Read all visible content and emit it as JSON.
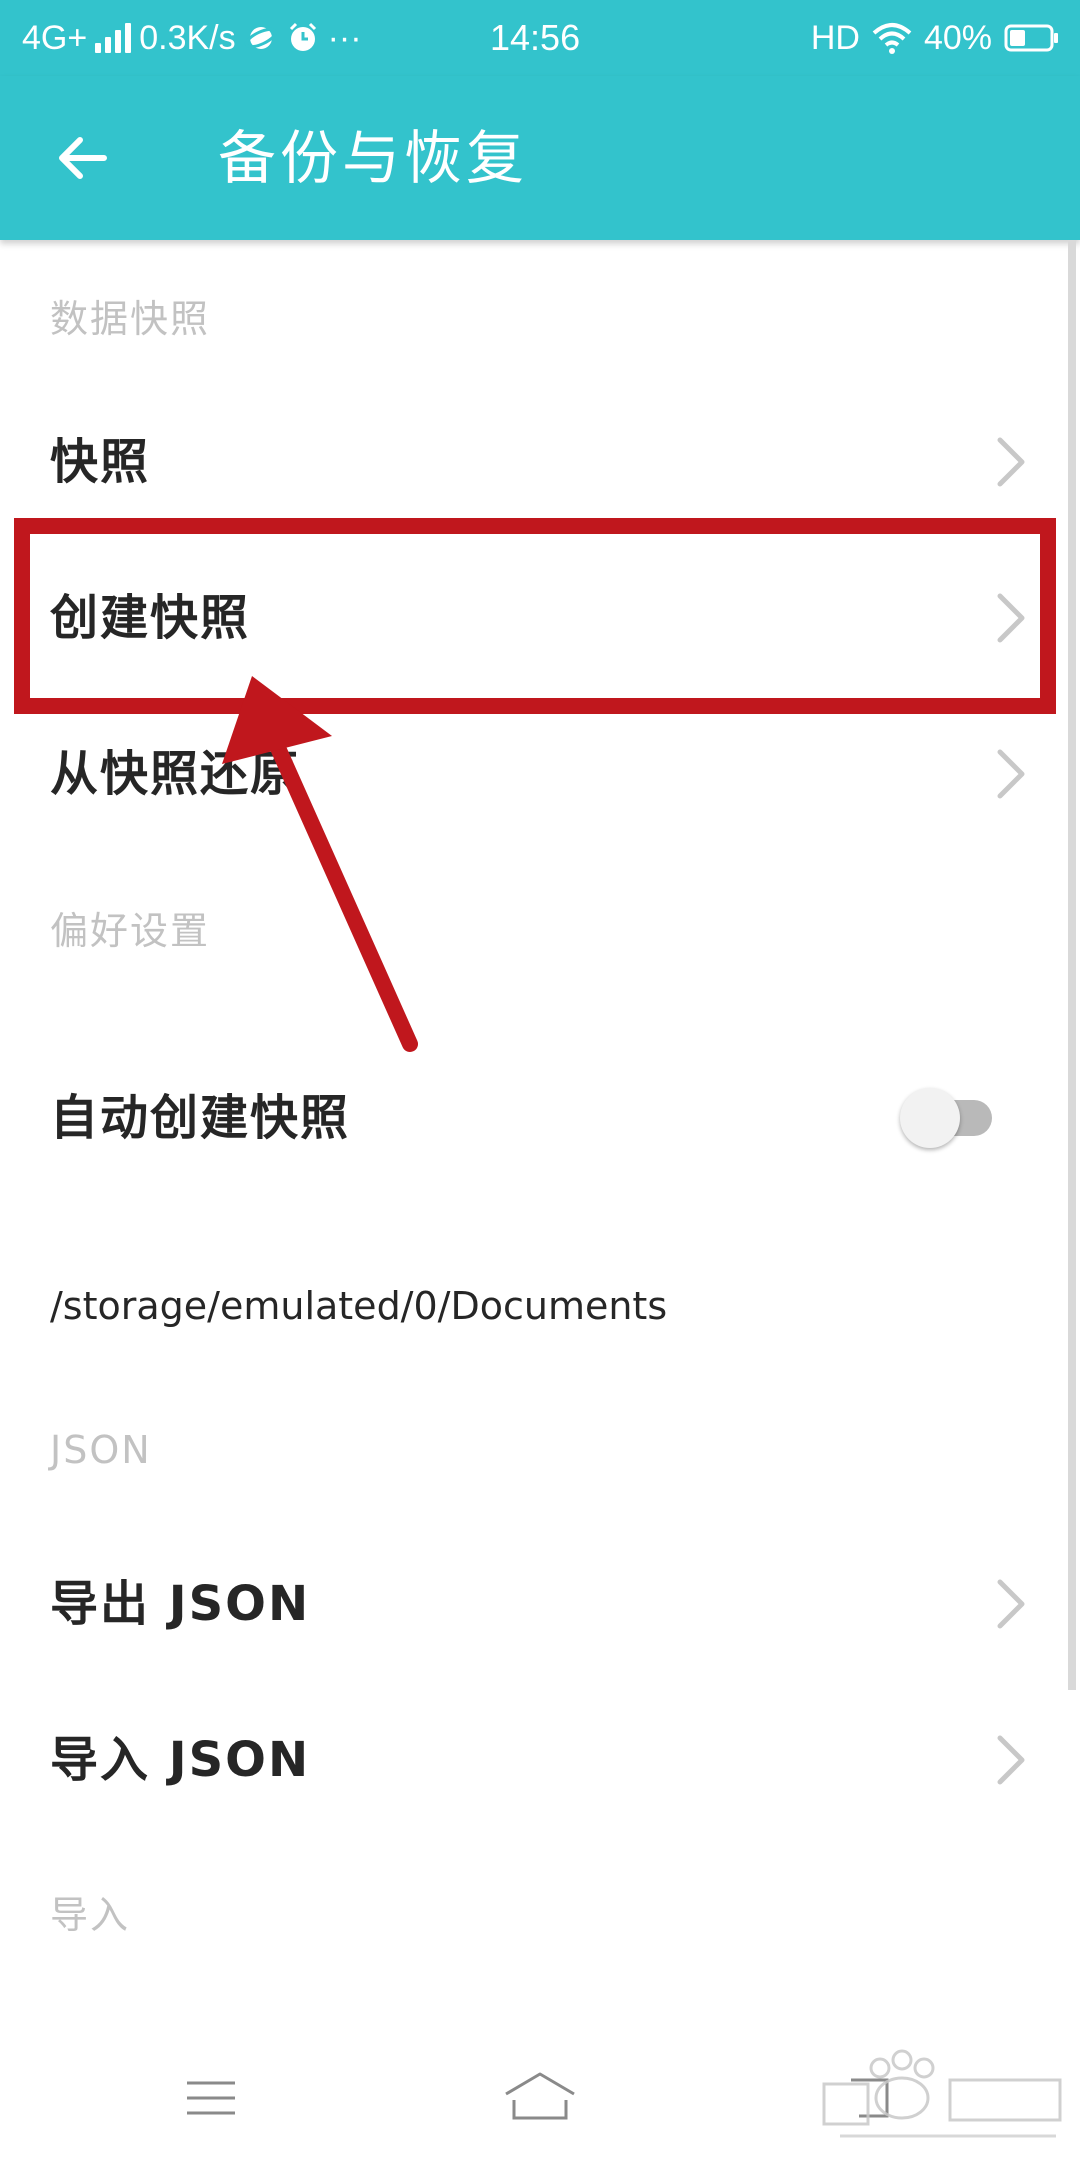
{
  "status_bar": {
    "network": "4G+",
    "speed": "0.3K/s",
    "more": "···",
    "time": "14:56",
    "hd": "HD",
    "battery": "40%",
    "battery_level": 0.4
  },
  "app_bar": {
    "title": "备份与恢复",
    "back_icon": "arrow-back-icon"
  },
  "sections": {
    "snapshot_header": "数据快照",
    "preferences_header": "偏好设置",
    "json_header": "JSON",
    "import_header": "导入"
  },
  "items": {
    "snapshot": "快照",
    "create_snapshot": "创建快照",
    "restore_snapshot": "从快照还原",
    "auto_create_snapshot": "自动创建快照",
    "auto_create_enabled": false,
    "storage_path": "/storage/emulated/0/Documents",
    "export_json": "导出 JSON",
    "import_json": "导入 JSON"
  },
  "icons": {
    "chevron": "chevron-right-icon",
    "nav_menu": "menu-icon",
    "nav_home": "home-icon",
    "nav_back": "back-icon"
  },
  "annotation": {
    "highlight_color": "#c0171d"
  },
  "colors": {
    "primary": "#33c3cc",
    "text": "#262626",
    "header_text": "#c2c2c2"
  }
}
